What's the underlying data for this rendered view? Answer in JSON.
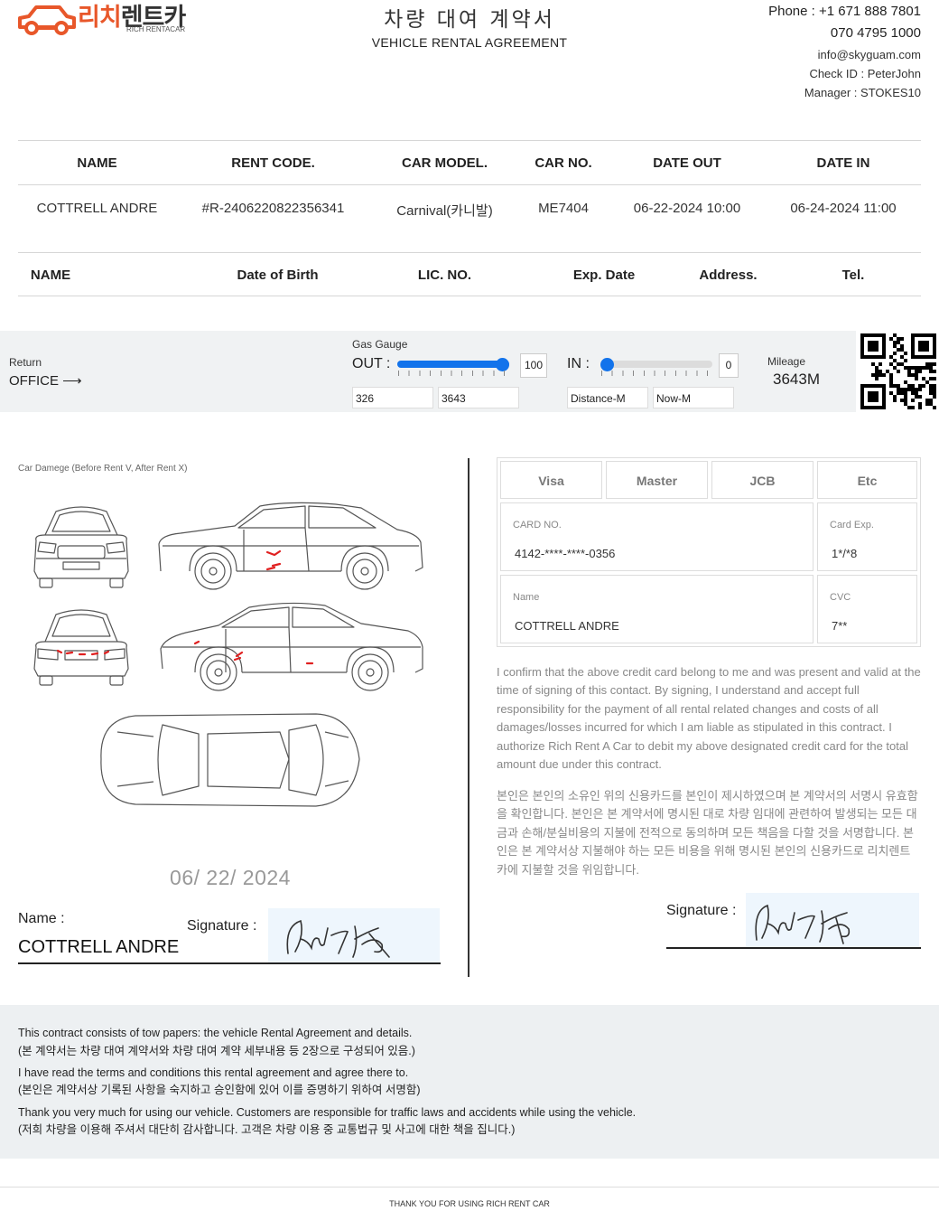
{
  "header": {
    "logo_kr_a": "리치",
    "logo_kr_b": "렌트카",
    "logo_en": "RICH RENTACAR",
    "title_kr": "차량 대여 계약서",
    "title_en": "VEHICLE RENTAL AGREEMENT",
    "phone1": "Phone : +1 671 888 7801",
    "phone2": "070 4795 1000",
    "email": "info@skyguam.com",
    "check_id": "Check ID : PeterJohn",
    "manager": "Manager : STOKES10"
  },
  "rental_table": {
    "headers": [
      "NAME",
      "RENT CODE.",
      "CAR MODEL.",
      "CAR NO.",
      "DATE OUT",
      "DATE IN"
    ],
    "row": [
      "COTTRELL ANDRE",
      "#R-2406220822356341",
      "Carnival(카니발)",
      "ME7404",
      "06-22-2024 10:00",
      "06-24-2024 11:00"
    ]
  },
  "driver_table": {
    "headers": [
      "NAME",
      "Date of Birth",
      "LIC. NO.",
      "Exp. Date",
      "Address.",
      "Tel."
    ]
  },
  "gauge": {
    "return_label": "Return",
    "return_value": "OFFICE ⟶",
    "gas_label": "Gas Gauge",
    "out_label": "OUT :",
    "out_value": "100",
    "out_level": 1.0,
    "in_label": "IN :",
    "in_value": "0",
    "in_level": 0.0,
    "field1": "326",
    "field2": "3643",
    "field3": "Distance-M",
    "field4": "Now-M",
    "mileage_label": "Mileage",
    "mileage_value": "3643M"
  },
  "damage": {
    "caption": "Car Damege (Before Rent V, After Rent X)",
    "date": "06/ 22/ 2024",
    "name_label": "Name :",
    "name_value": "COTTRELL ANDRE",
    "signature_label": "Signature :"
  },
  "payment": {
    "card_types": [
      "Visa",
      "Master",
      "JCB",
      "Etc"
    ],
    "card_no_label": "CARD NO.",
    "card_no": "4142-****-****-0356",
    "card_exp_label": "Card Exp.",
    "card_exp": "1*/*8",
    "name_label": "Name",
    "name": "COTTRELL ANDRE",
    "cvc_label": "CVC",
    "cvc": "7**",
    "terms_en": "I confirm that the above credit card belong to me and was present and valid at the time of signing of this contact. By signing, I understand and accept full responsibility for the payment of all rental related changes and costs of all damages/losses incurred for which I am liable as stipulated in this contract. I authorize Rich Rent A Car to debit my above designated credit card for the total amount due under this contract.",
    "terms_kr": "본인은 본인의 소유인 위의 신용카드를 본인이 제시하였으며 본 계약서의 서명시 유효함을 확인합니다. 본인은 본 계약서에 명시된 대로 차량 임대에 관련하여 발생되는 모든 대금과 손해/분실비용의 지불에 전적으로 동의하며 모든 책음을 다할 것을 서명합니다. 본인은 본 계약서상 지불해야 하는 모든 비용을 위해 명시된 본인의 신용카드로 리치렌트카에 지불할 것을 위임합니다.",
    "signature_label": "Signature :"
  },
  "footer": {
    "line1_en": "This contract consists of tow papers: the vehicle Rental Agreement and details.",
    "line1_kr": "(본 계약서는 차량 대여 계약서와 차량 대여 계약 세부내용 등 2장으로 구성되어 있음.)",
    "line2_en": "I have read the terms and conditions this rental agreement and agree there to.",
    "line2_kr": "(본인은 계약서상 기록된 사항을 숙지하고 승인함에 있어 이를 증명하기 위하여 서명함)",
    "line3_en": "Thank you very much for using our vehicle. Customers are responsible for traffic laws and accidents while using the vehicle.",
    "line3_kr": "(저희 차량을 이용해 주셔서 대단히 감사합니다. 고객은 차량 이용 중 교통법규 및 사고에 대한 책을 집니다.)",
    "thanks": "THANK YOU FOR USING RICH RENT CAR"
  },
  "colors": {
    "brand": "#e8572a",
    "slider": "#1273eb",
    "damage_mark": "#e02020",
    "band": "#f0f2f3"
  }
}
